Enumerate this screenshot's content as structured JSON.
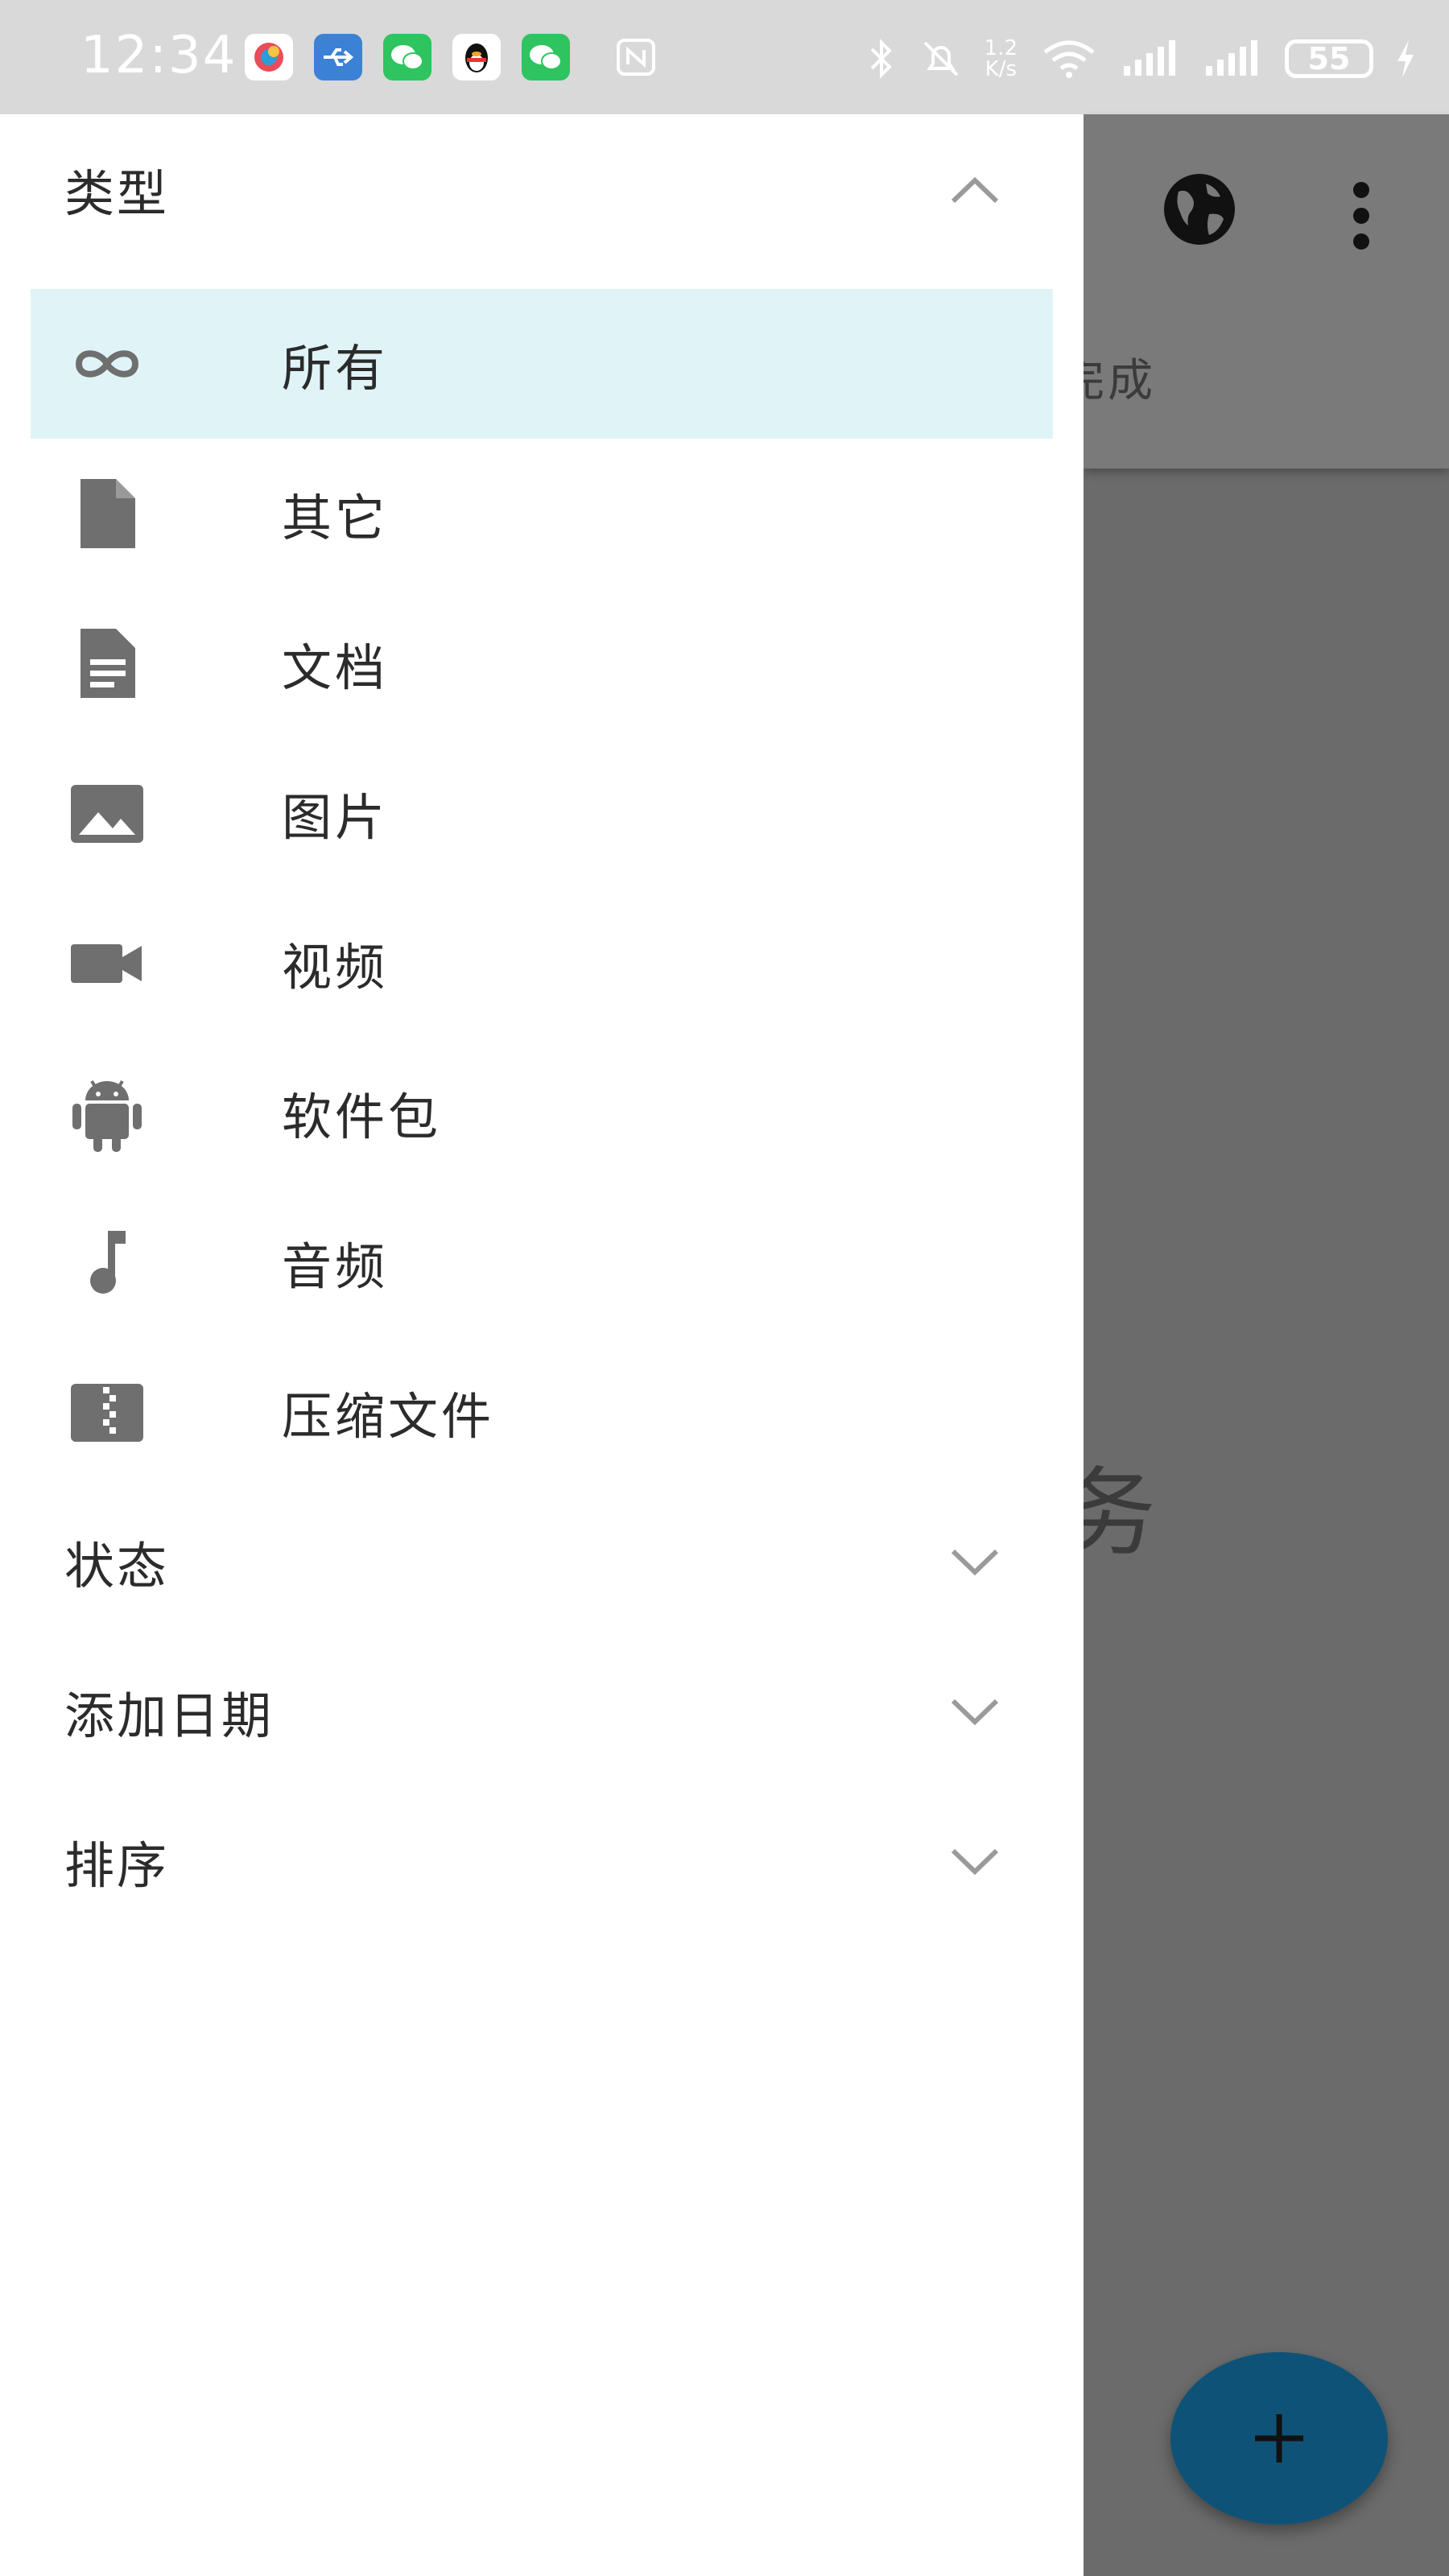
{
  "status_bar": {
    "time": "12:34",
    "network_speed_value": "1.2",
    "network_speed_unit": "K/s",
    "battery": "55",
    "icons": [
      "app-icon",
      "usb-icon",
      "wechat-icon",
      "qq-icon",
      "wechat-icon",
      "nfc-icon",
      "bluetooth-icon",
      "mute-icon",
      "wifi-icon",
      "signal-icon",
      "signal-icon",
      "battery-icon",
      "charging-icon"
    ]
  },
  "background_app": {
    "tab_fragment": "完成",
    "empty_fragment": "务",
    "toolbar_icons": [
      "globe-icon",
      "more-vert-icon"
    ],
    "fab_icon": "plus-icon",
    "accent_color": "#0e5377"
  },
  "drawer": {
    "sections": [
      {
        "title": "类型",
        "expanded": true,
        "items": [
          {
            "label": "所有",
            "icon": "infinity-icon",
            "selected": true
          },
          {
            "label": "其它",
            "icon": "file-icon",
            "selected": false
          },
          {
            "label": "文档",
            "icon": "document-icon",
            "selected": false
          },
          {
            "label": "图片",
            "icon": "image-icon",
            "selected": false
          },
          {
            "label": "视频",
            "icon": "video-icon",
            "selected": false
          },
          {
            "label": "软件包",
            "icon": "android-icon",
            "selected": false
          },
          {
            "label": "音频",
            "icon": "music-note-icon",
            "selected": false
          },
          {
            "label": "压缩文件",
            "icon": "archive-icon",
            "selected": false
          }
        ]
      },
      {
        "title": "状态",
        "expanded": false
      },
      {
        "title": "添加日期",
        "expanded": false
      },
      {
        "title": "排序",
        "expanded": false
      }
    ],
    "selected_color": "#e0f4f8",
    "icon_color": "#6f6f6f"
  }
}
